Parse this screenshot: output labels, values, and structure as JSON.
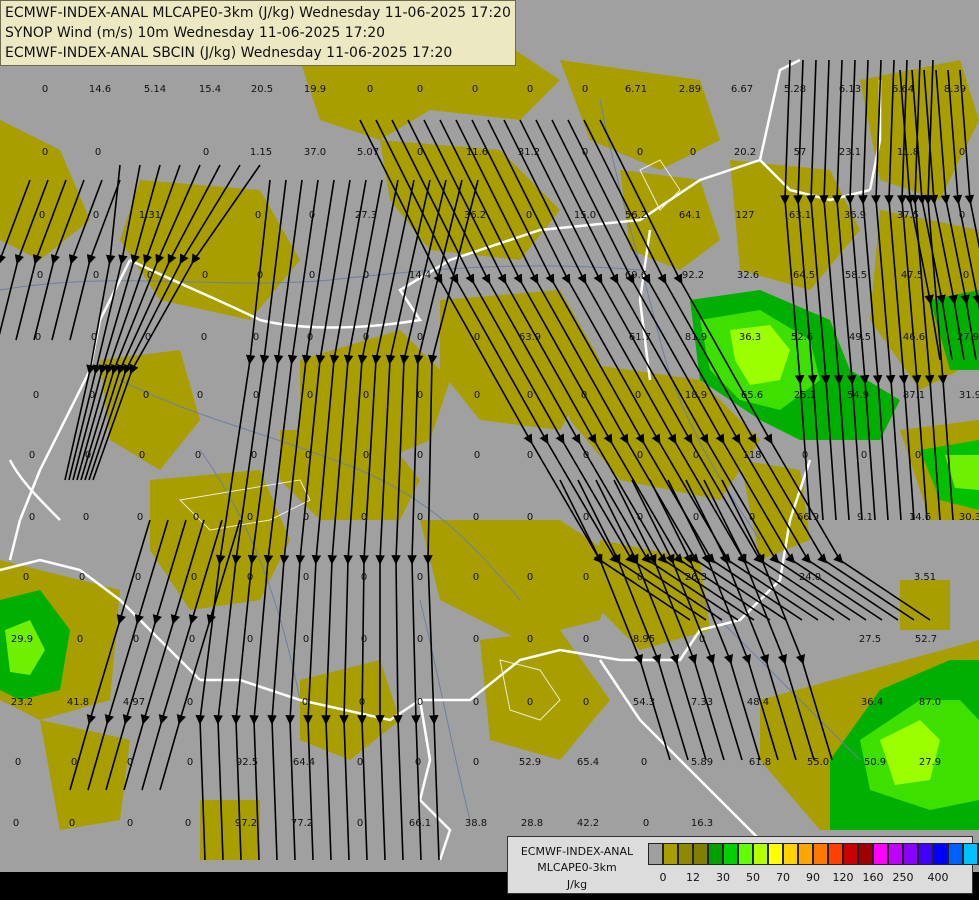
{
  "header": {
    "line1": "ECMWF-INDEX-ANAL MLCAPE0-3km (J/kg) Wednesday 11-06-2025 17:20",
    "line2": "SYNOP Wind (m/s) 10m Wednesday 11-06-2025 17:20",
    "line3": "ECMWF-INDEX-ANAL SBCIN (J/kg) Wednesday 11-06-2025 17:20"
  },
  "legend": {
    "title1": "ECMWF-INDEX-ANAL",
    "title2": "MLCAPE0-3km",
    "units": "J/kg",
    "swatch_colors": [
      "#a0a0a0",
      "#a89e00",
      "#8e8a00",
      "#7f7f00",
      "#00a000",
      "#00d000",
      "#62ff00",
      "#b4ff00",
      "#ffff00",
      "#ffd200",
      "#ffa500",
      "#ff7800",
      "#ff4000",
      "#c80000",
      "#a00000",
      "#ff00ff",
      "#c000ff",
      "#8a00ff",
      "#4000ff",
      "#0000ff",
      "#0060ff",
      "#00c0ff",
      "#40ffff",
      "#a0ffff",
      "#ffffff"
    ],
    "ticks": [
      "0",
      "12",
      "30",
      "50",
      "70",
      "90",
      "120",
      "160",
      "250",
      "400"
    ]
  },
  "map_values": [
    "0",
    "14.6",
    "5.14",
    "15.4",
    "20.5",
    "19.9",
    "0",
    "0",
    "0",
    "0",
    "0",
    "6.71",
    "2.89",
    "6.67",
    "5.28",
    "6.13",
    "6.64",
    "8.39",
    "0",
    "0",
    "0",
    "1.15",
    "37.0",
    "5.07",
    "0",
    "11.6",
    "31.2",
    "0",
    "0",
    "0",
    "20.2",
    "57",
    "23.1",
    "11.8",
    "0",
    "0",
    "0",
    "1.31",
    "0",
    "0",
    "27.3",
    "36.2",
    "0",
    "15.0",
    "56.2",
    "64.1",
    "127",
    "63.1",
    "36.9",
    "37.5",
    "0",
    "0",
    "0",
    "0",
    "0",
    "0",
    "0",
    "0",
    "14.4",
    "69.6",
    "92.2",
    "32.6",
    "64.5",
    "58.5",
    "47.5",
    "0",
    "0",
    "0",
    "0",
    "0",
    "0",
    "0",
    "0",
    "0",
    "0",
    "63.9",
    "61.7",
    "81.9",
    "36.3",
    "52.6",
    "49.5",
    "46.6",
    "27.9",
    "0",
    "0",
    "0",
    "0",
    "0",
    "0",
    "0",
    "0",
    "0",
    "0",
    "0",
    "0",
    "18.9",
    "65.6",
    "25.1",
    "54.9",
    "87.1",
    "31.9",
    "0",
    "0",
    "0",
    "0",
    "0",
    "0",
    "0",
    "0",
    "0",
    "0",
    "0",
    "0",
    "0",
    "118",
    "0",
    "0",
    "0",
    "0",
    "0",
    "0",
    "0",
    "0",
    "0",
    "0",
    "0",
    "0",
    "0",
    "0",
    "0",
    "0",
    "0",
    "66.9",
    "9.1",
    "14.6",
    "30.3",
    "0",
    "0",
    "0",
    "0",
    "0",
    "0",
    "0",
    "0",
    "0",
    "0",
    "0",
    "0",
    "26.3",
    "24.0",
    "3.51",
    "29.9",
    "0",
    "0",
    "0",
    "0",
    "0",
    "0",
    "0",
    "0",
    "0",
    "0",
    "8.95",
    "0",
    "27.5",
    "52.7",
    "23.2",
    "41.8",
    "4.97",
    "0",
    "0",
    "0",
    "0",
    "0",
    "0",
    "0",
    "54.3",
    "7.33",
    "48.4",
    "36.4",
    "87.0",
    "0",
    "0",
    "0",
    "0",
    "92.5",
    "64.4",
    "0",
    "0",
    "0",
    "52.9",
    "65.4",
    "0",
    "5.89",
    "61.8",
    "55.0",
    "50.9",
    "27.9",
    "0",
    "0",
    "0",
    "0",
    "97.2",
    "77.2",
    "0",
    "66.1",
    "38.8",
    "28.8",
    "42.2",
    "0",
    "16.3"
  ]
}
